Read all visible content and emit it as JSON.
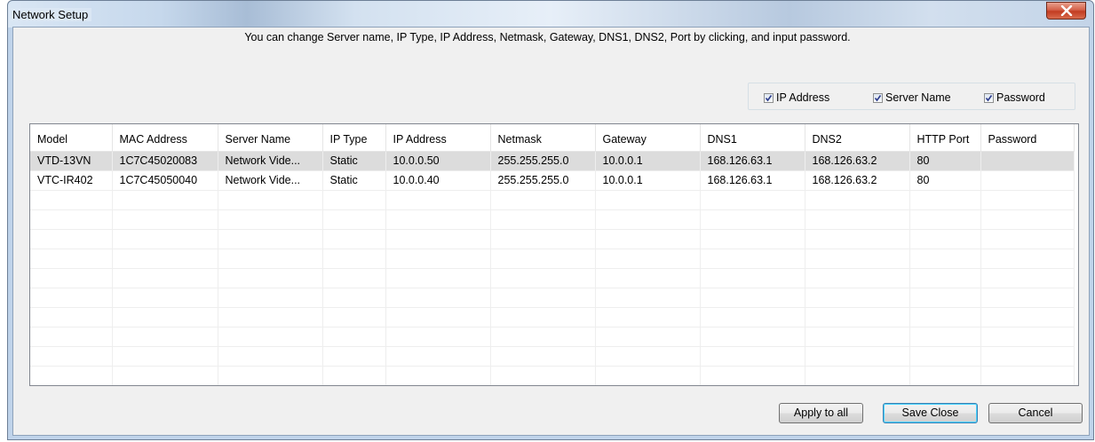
{
  "window": {
    "title": "Network Setup"
  },
  "instruction": "You can change Server name, IP Type, IP Address, Netmask, Gateway, DNS1, DNS2, Port by clicking, and input password.",
  "options": [
    {
      "label": "IP Address",
      "checked": true
    },
    {
      "label": "Server Name",
      "checked": true
    },
    {
      "label": "Password",
      "checked": true
    }
  ],
  "table": {
    "columns": [
      "Model",
      "MAC Address",
      "Server Name",
      "IP Type",
      "IP Address",
      "Netmask",
      "Gateway",
      "DNS1",
      "DNS2",
      "HTTP Port",
      "Password"
    ],
    "rows": [
      [
        "VTD-13VN",
        "1C7C45020083",
        "Network Vide...",
        "Static",
        "10.0.0.50",
        "255.255.255.0",
        "10.0.0.1",
        "168.126.63.1",
        "168.126.63.2",
        "80",
        ""
      ],
      [
        "VTC-IR402",
        "1C7C45050040",
        "Network Vide...",
        "Static",
        "10.0.0.40",
        "255.255.255.0",
        "10.0.0.1",
        "168.126.63.1",
        "168.126.63.2",
        "80",
        ""
      ]
    ],
    "selected_row": 0
  },
  "buttons": {
    "apply_all": "Apply to all",
    "save_close": "Save Close",
    "cancel": "Cancel"
  },
  "icons": {
    "close": "close-x-icon",
    "check": "checkmark-icon"
  },
  "colors": {
    "close_button": "#c8442a",
    "selected_row": "#dcdcdc",
    "frame": "#bfd3ea"
  }
}
